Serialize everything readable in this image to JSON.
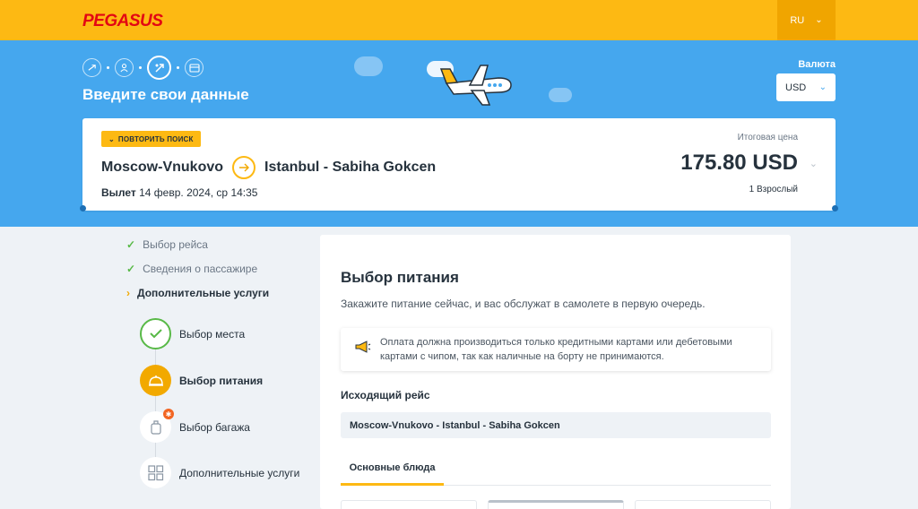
{
  "header": {
    "brand": "PEGASUS",
    "language": "RU"
  },
  "hero": {
    "title": "Введите свои данные",
    "steps": [
      "flight-icon",
      "passenger-icon",
      "extras-icon",
      "payment-icon"
    ],
    "active_step": 2,
    "currency_label": "Валюта",
    "currency_value": "USD"
  },
  "summary": {
    "repeat_search": "ПОВТОРИТЬ ПОИСК",
    "origin": "Moscow-Vnukovo",
    "destination": "Istanbul - Sabiha Gokcen",
    "depart_label": "Вылет",
    "depart_value": "14 февр. 2024, ср 14:35",
    "total_label": "Итоговая цена",
    "total_price": "175.80 USD",
    "passengers": "1 Взрослый"
  },
  "sidebar": {
    "items": [
      {
        "label": "Выбор рейса",
        "state": "done"
      },
      {
        "label": "Сведения о пассажире",
        "state": "done"
      },
      {
        "label": "Дополнительные услуги",
        "state": "current"
      }
    ],
    "sub_items": [
      {
        "label": "Выбор места",
        "icon": "check-icon",
        "state": "done"
      },
      {
        "label": "Выбор питания",
        "icon": "cloche-icon",
        "state": "current"
      },
      {
        "label": "Выбор багажа",
        "icon": "suitcase-icon",
        "state": "pending"
      },
      {
        "label": "Дополнительные услуги",
        "icon": "grid-icon",
        "state": "pending"
      }
    ]
  },
  "meal": {
    "title": "Выбор питания",
    "description": "Закажите питание сейчас, и вас обслужат в самолете в первую очередь.",
    "notice": "Оплата должна производиться только кредитными картами или дебетовыми картами с чипом, так как наличные на борту не принимаются.",
    "outbound_label": "Исходящий рейс",
    "flight": "Moscow-Vnukovo - Istanbul - Sabiha Gokcen",
    "tabs": [
      {
        "label": "Основные блюда"
      }
    ]
  },
  "colors": {
    "brand_yellow": "#fdb913",
    "hero_blue": "#45a7ee",
    "brand_red": "#e30613",
    "success_green": "#58b947"
  }
}
